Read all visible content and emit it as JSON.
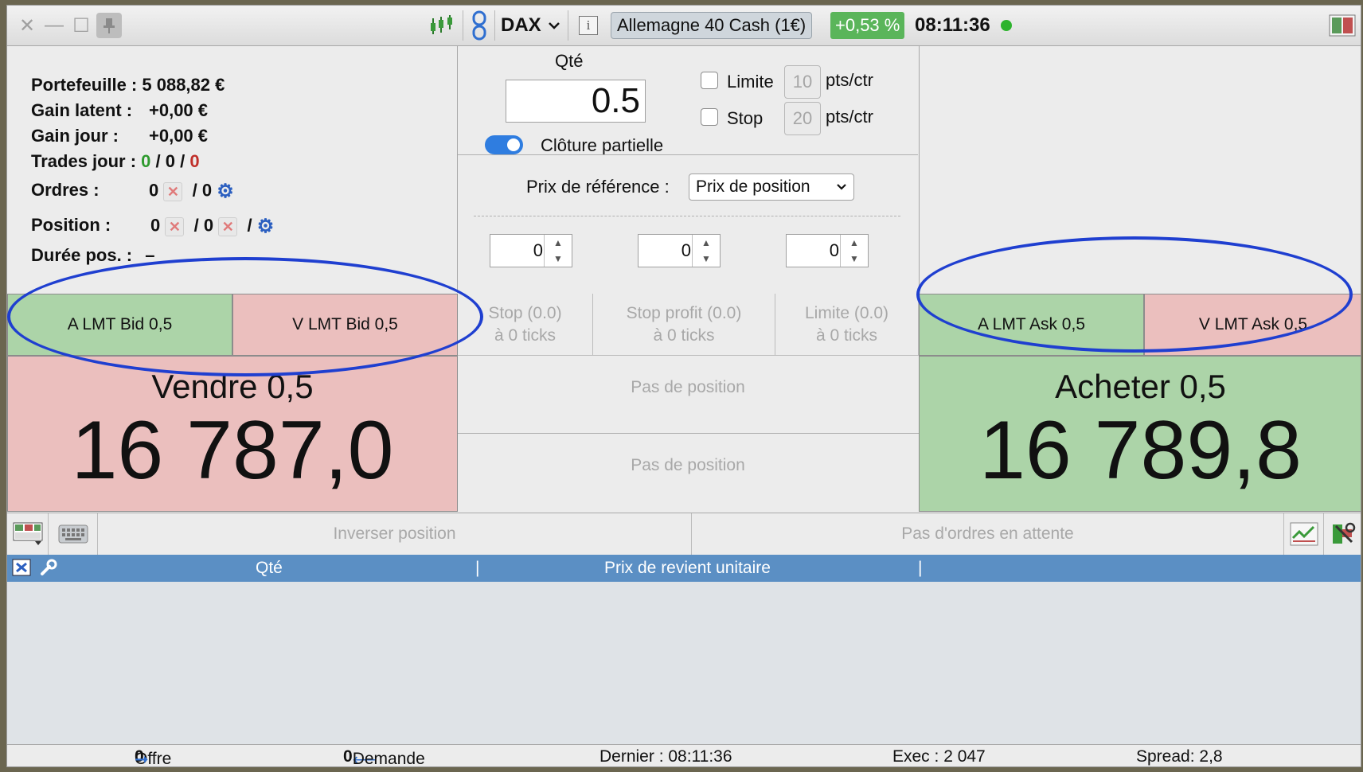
{
  "titlebar": {
    "instrument": "DAX",
    "market_name": "Allemagne 40 Cash (1€)",
    "change_pct": "+0,53 %",
    "time": "08:11:36",
    "close_glyph": "✕",
    "minimize_glyph": "—",
    "maximize_glyph": "☐"
  },
  "account": {
    "portefeuille_label": "Portefeuille :",
    "portefeuille_value": "5 088,82 €",
    "gain_latent_label": "Gain latent :",
    "gain_latent_value": "+0,00 €",
    "gain_jour_label": "Gain jour :",
    "gain_jour_value": "+0,00 €",
    "trades_jour_label": "Trades jour :",
    "trades_win": "0",
    "trades_mid": "0",
    "trades_loss": "0",
    "ordres_label": "Ordres :",
    "ordres_a": "0",
    "ordres_b": "0",
    "position_label": "Position :",
    "position_a": "0",
    "position_b": "0",
    "duree_label": "Durée pos. :",
    "duree_value": "–",
    "sep": "/"
  },
  "order_form": {
    "qty_label": "Qté",
    "qty_value": "0.5",
    "limite_label": "Limite",
    "limite_value": "10",
    "stop_label": "Stop",
    "stop_value": "20",
    "unit": "pts/ctr",
    "partial_close_label": "Clôture partielle",
    "ref_price_label": "Prix de référence :",
    "ref_price_value": "Prix de position",
    "spinners": [
      "0",
      "0",
      "0"
    ]
  },
  "buttons": {
    "buy_lmt_bid": "A LMT Bid 0,5",
    "sell_lmt_bid": "V LMT Bid 0,5",
    "buy_lmt_ask": "A LMT Ask 0,5",
    "sell_lmt_ask": "V LMT Ask 0,5",
    "sell_title": "Vendre 0,5",
    "sell_price": "16 787,0",
    "buy_title": "Acheter 0,5",
    "buy_price": "16 789,8"
  },
  "position_info": {
    "stop_line1": "Stop (0.0)",
    "stop_line2": "à 0 ticks",
    "stop_profit_line1": "Stop profit (0.0)",
    "stop_profit_line2": "à 0 ticks",
    "limite_line1": "Limite (0.0)",
    "limite_line2": "à 0 ticks",
    "no_position_1": "Pas de position",
    "no_position_2": "Pas de position"
  },
  "toolbar": {
    "reverse_position": "Inverser position",
    "no_pending_orders": "Pas d'ordres en attente"
  },
  "table": {
    "col_qty": "Qté",
    "col_unit_cost": "Prix de revient unitaire"
  },
  "status": {
    "offre_label": "Offre",
    "offre_value": "0",
    "demande_value": "0",
    "demande_label": "Demande",
    "dernier": "Dernier : 08:11:36",
    "exec": "Exec : 2 047",
    "spread": "Spread: 2,8"
  },
  "colors": {
    "sell_bg": "#ebbfbe",
    "buy_bg": "#acd4a8",
    "annotation": "#1f3fd0",
    "table_header": "#5b8fc4"
  }
}
